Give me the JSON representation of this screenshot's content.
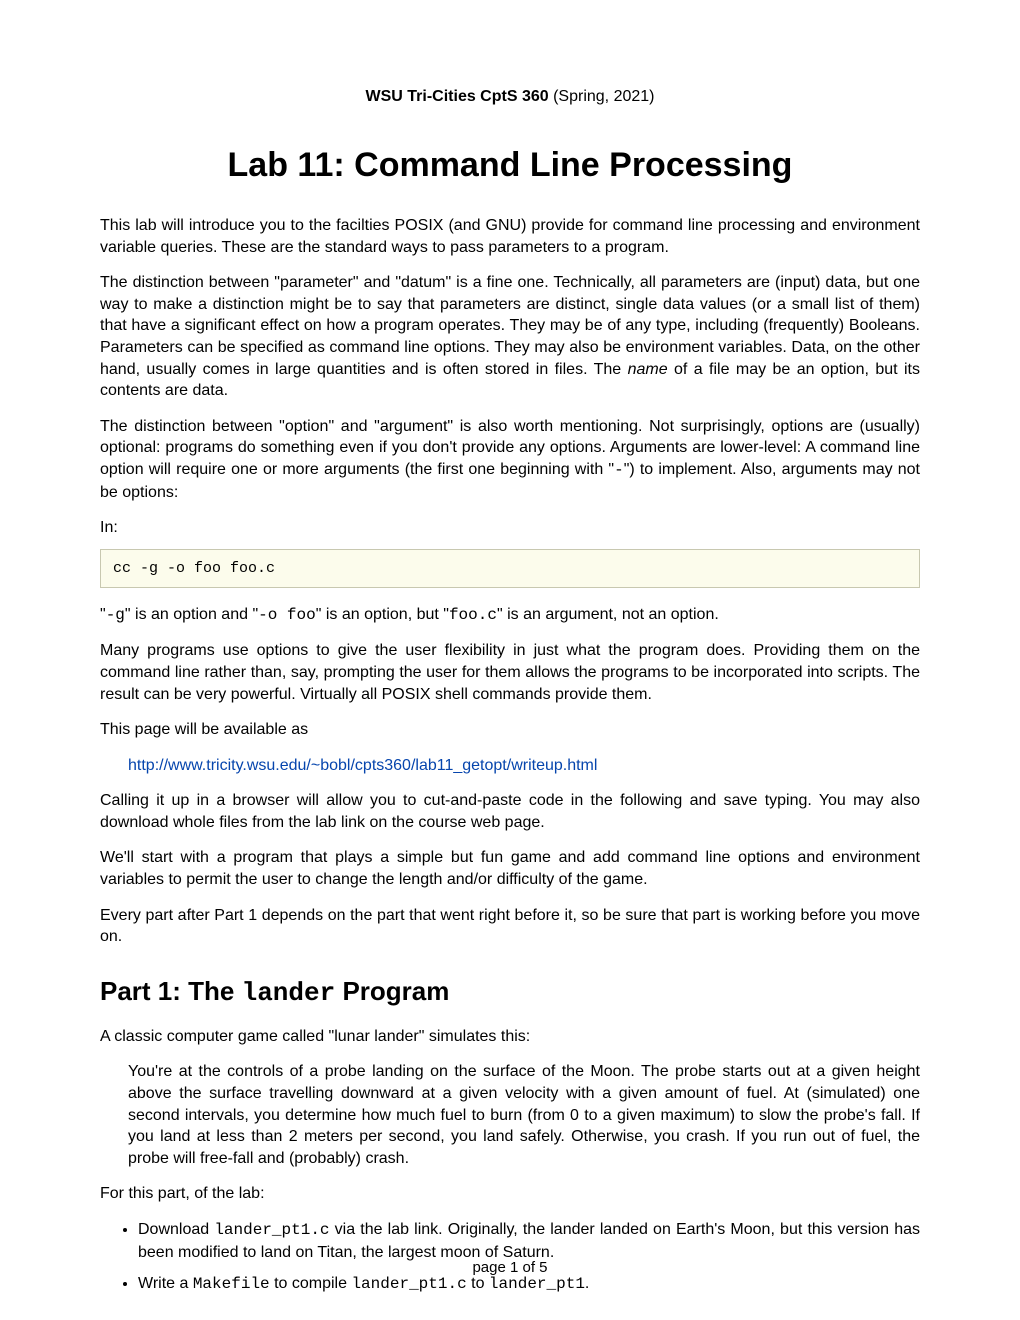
{
  "header": {
    "course_bold": "WSU Tri-Cities CptS 360",
    "course_term": " (Spring, 2021)"
  },
  "title": "Lab 11: Command Line Processing",
  "para1": "This lab will introduce you to the facilties POSIX (and GNU) provide for command line processing and environment variable queries. These are the standard ways to pass parameters to a program.",
  "para2_a": "The distinction between \"parameter\" and \"datum\" is a fine one. Technically, all parameters are (input) data, but one way to make a distinction might be to say that parameters are distinct, single data values (or a small list of them) that have a significant effect on how a program operates. They may be of any type, including (frequently) Booleans. Parameters can be specified as command line options. They may also be environment variables. Data, on the other hand, usually comes in large quantities and is often stored in files. The ",
  "para2_em": "name",
  "para2_b": " of a file may be an option, but its contents are data.",
  "para3_a": "The distinction between \"option\" and \"argument\" is also worth mentioning. Not surprisingly, options are (usually) optional: programs do something even if you don't provide any options. Arguments are lower-level: A command line option will require one or more arguments (the first one beginning with \"",
  "para3_dash": "-",
  "para3_b": "\") to implement. Also, arguments may not be options:",
  "in_label": "In:",
  "codeblock1": "cc -g -o foo foo.c",
  "para4_a": "\"",
  "para4_c1": "-g",
  "para4_b": "\" is an option and \"",
  "para4_c2": "-o foo",
  "para4_c": "\" is an option, but \"",
  "para4_c3": "foo.c",
  "para4_d": "\" is an argument, not an option.",
  "para5": "Many programs use options to give the user flexibility in just what the program does. Providing them on the command line rather than, say, prompting the user for them allows the programs to be incorporated into scripts. The result can be very powerful. Virtually all POSIX shell commands provide them.",
  "para6": "This page will be available as",
  "link_url": "http://www.tricity.wsu.edu/~bobl/cpts360/lab11_getopt/writeup.html",
  "para7": "Calling it up in a browser will allow you to cut-and-paste code in the following and save typing. You may also download whole files from the lab link on the course web page.",
  "para8": "We'll start with a program that plays a simple but fun game and add command line options and environment variables to permit the user to change the length and/or difficulty of the game.",
  "para9": "Every part after Part 1 depends on the part that went right before it, so be sure that part is working before you move on.",
  "h2_a": "Part 1: The ",
  "h2_code": "lander",
  "h2_b": " Program",
  "para10": "A classic computer game called \"lunar lander\" simulates this:",
  "quote1": "You're at the controls of a probe landing on the surface of the Moon. The probe starts out at a given height above the surface travelling downward at a given velocity with a given amount of fuel. At (simulated) one second intervals, you determine how much fuel to burn (from 0 to a given maximum) to slow the probe's fall. If you land at less than 2 meters per second, you land safely. Otherwise, you crash. If you run out of fuel, the probe will free-fall and (probably) crash.",
  "para11": "For this part, of the lab:",
  "li1_a": "Download ",
  "li1_code": "lander_pt1.c",
  "li1_b": " via the lab link. Originally, the lander landed on Earth's Moon, but this version has been modified to land on Titan, the largest moon of Saturn.",
  "li2_a": "Write a ",
  "li2_code1": "Makefile",
  "li2_b": " to compile ",
  "li2_code2": "lander_pt1.c",
  "li2_c": " to ",
  "li2_code3": "lander_pt1",
  "li2_d": ".",
  "pagenum": "page 1 of 5"
}
